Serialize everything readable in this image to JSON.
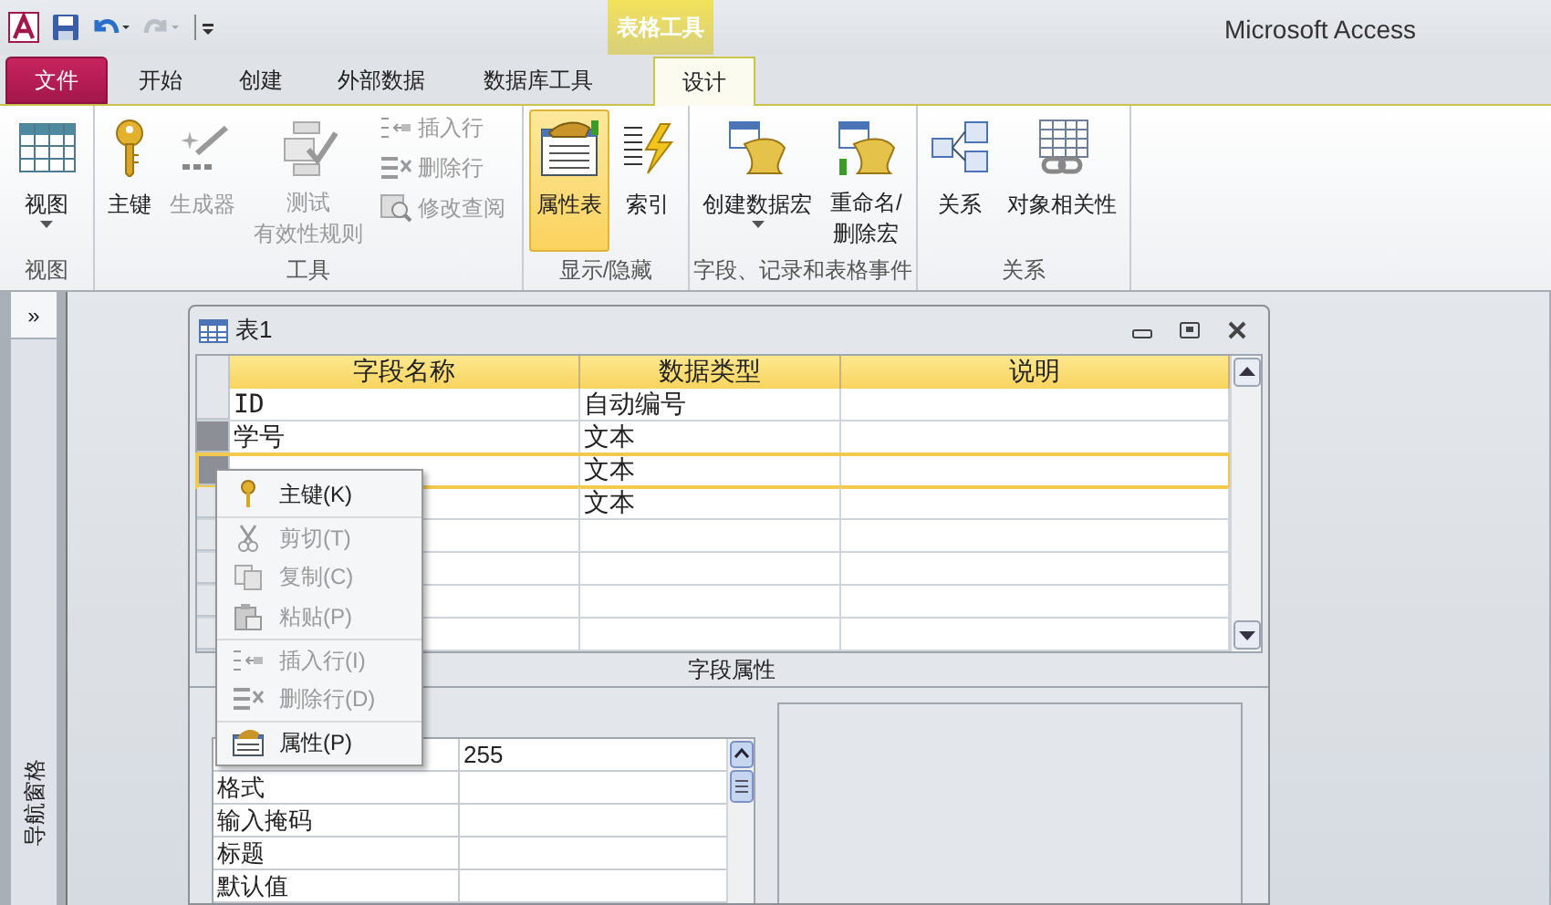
{
  "app_title": "Microsoft Access",
  "contextual_tab_group": "表格工具",
  "tabs": [
    {
      "label": "文件",
      "kind": "file",
      "selected": false
    },
    {
      "label": "开始",
      "kind": "normal",
      "selected": false
    },
    {
      "label": "创建",
      "kind": "normal",
      "selected": false
    },
    {
      "label": "外部数据",
      "kind": "normal",
      "selected": false
    },
    {
      "label": "数据库工具",
      "kind": "normal",
      "selected": false
    },
    {
      "label": "设计",
      "kind": "contextual",
      "selected": true
    }
  ],
  "ribbon_groups": [
    {
      "label": "视图",
      "buttons": [
        {
          "kind": "large",
          "lines": [
            "视图"
          ],
          "dropdown": true,
          "disabled": false,
          "selected": false
        }
      ]
    },
    {
      "label": "工具",
      "buttons": [
        {
          "kind": "large",
          "lines": [
            "主键"
          ],
          "dropdown": false,
          "disabled": false,
          "selected": false
        },
        {
          "kind": "large",
          "lines": [
            "生成器"
          ],
          "dropdown": false,
          "disabled": true,
          "selected": false
        },
        {
          "kind": "large",
          "lines": [
            "测试",
            "有效性规则"
          ],
          "dropdown": false,
          "disabled": true,
          "selected": false
        },
        {
          "kind": "small",
          "lines": [
            "插入行"
          ],
          "dropdown": false,
          "disabled": true,
          "selected": false
        },
        {
          "kind": "small",
          "lines": [
            "删除行"
          ],
          "dropdown": false,
          "disabled": true,
          "selected": false
        },
        {
          "kind": "small",
          "lines": [
            "修改查阅"
          ],
          "dropdown": false,
          "disabled": true,
          "selected": false
        }
      ]
    },
    {
      "label": "显示/隐藏",
      "buttons": [
        {
          "kind": "large",
          "lines": [
            "属性表"
          ],
          "dropdown": false,
          "disabled": false,
          "selected": true
        },
        {
          "kind": "large",
          "lines": [
            "索引"
          ],
          "dropdown": false,
          "disabled": false,
          "selected": false
        }
      ]
    },
    {
      "label": "字段、记录和表格事件",
      "buttons": [
        {
          "kind": "large",
          "lines": [
            "创建数据宏"
          ],
          "dropdown": true,
          "disabled": false,
          "selected": false
        },
        {
          "kind": "large",
          "lines": [
            "重命名/",
            "删除宏"
          ],
          "dropdown": false,
          "disabled": false,
          "selected": false
        }
      ]
    },
    {
      "label": "关系",
      "buttons": [
        {
          "kind": "large",
          "lines": [
            "关系"
          ],
          "dropdown": false,
          "disabled": false,
          "selected": false
        },
        {
          "kind": "large",
          "lines": [
            "对象相关性"
          ],
          "dropdown": false,
          "disabled": false,
          "selected": false
        }
      ]
    }
  ],
  "navigation_pane": {
    "toggle": "»",
    "label": "导航窗格"
  },
  "table_window": {
    "title": "表1",
    "columns": [
      "字段名称",
      "数据类型",
      "说明"
    ],
    "rows": [
      {
        "field_name": "ID",
        "data_type": "自动编号",
        "selected": false,
        "current": false
      },
      {
        "field_name": "学号",
        "data_type": "文本",
        "selected": true,
        "current": false
      },
      {
        "data_type": "文本",
        "selected": true,
        "current": true
      },
      {
        "data_type": "文本",
        "selected": false,
        "current": false
      }
    ],
    "section_label": "字段属性",
    "properties": [
      {
        "value": "255"
      },
      {
        "label": "格式"
      },
      {
        "label": "输入掩码"
      },
      {
        "label": "标题"
      },
      {
        "label": "默认值"
      }
    ]
  },
  "context_menu": [
    {
      "label": "主键(K)",
      "disabled": false,
      "separator_before": false
    },
    {
      "label": "剪切(T)",
      "disabled": true,
      "separator_before": true
    },
    {
      "label": "复制(C)",
      "disabled": true,
      "separator_before": false
    },
    {
      "label": "粘贴(P)",
      "disabled": true,
      "separator_before": false
    },
    {
      "label": "插入行(I)",
      "disabled": true,
      "separator_before": true
    },
    {
      "label": "删除行(D)",
      "disabled": true,
      "separator_before": false
    },
    {
      "label": "属性(P)",
      "disabled": false,
      "separator_before": true
    }
  ]
}
